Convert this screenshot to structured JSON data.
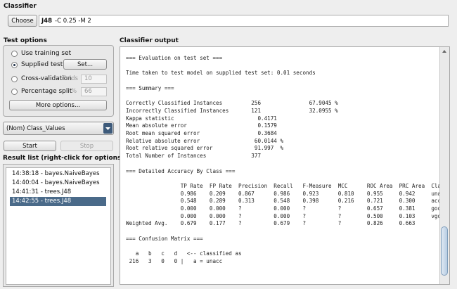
{
  "classifier": {
    "section_title": "Classifier",
    "choose_label": "Choose",
    "algo_name": "J48",
    "algo_args": "-C 0.25 -M 2"
  },
  "test_options": {
    "title": "Test options",
    "use_training": "Use training set",
    "supplied_test": "Supplied test set",
    "set_label": "Set...",
    "cross_validation": "Cross-validation",
    "folds_label": "Folds",
    "folds_value": "10",
    "percentage_split": "Percentage split",
    "percent_label": "%",
    "percent_value": "66",
    "selected": "supplied_test",
    "more_options": "More options..."
  },
  "class_select": {
    "value": "(Nom) Class_Values"
  },
  "controls": {
    "start": "Start",
    "stop": "Stop"
  },
  "result_list": {
    "title": "Result list (right-click for options)",
    "items": [
      "14:38:18 - bayes.NaiveBayes",
      "14:40:04 - bayes.NaiveBayes",
      "14:41:31 - trees.J48",
      "14:42:55 - trees.J48"
    ],
    "selected_index": 3
  },
  "output": {
    "title": "Classifier output",
    "text": "=== Evaluation on test set ===\n\nTime taken to test model on supplied test set: 0.01 seconds\n\n=== Summary ===\n\nCorrectly Classified Instances         256               67.9045 %\nIncorrectly Classified Instances       121               32.0955 %\nKappa statistic                          0.4171\nMean absolute error                      0.1579\nRoot mean squared error                  0.3684\nRelative absolute error                 60.0144 %\nRoot relative squared error             91.997  %\nTotal Number of Instances              377\n\n=== Detailed Accuracy By Class ===\n\n                 TP Rate  FP Rate  Precision  Recall   F-Measure  MCC      ROC Area  PRC Area  Class\n                 0.986    0.209    0.867      0.986    0.923      0.810    0.955     0.942     unacc\n                 0.548    0.289    0.313      0.548    0.398      0.216    0.721     0.300     acc\n                 0.000    0.000    ?          0.000    ?          ?        0.657     0.381     good\n                 0.000    0.000    ?          0.000    ?          ?        0.500     0.103     vgood\nWeighted Avg.    0.679    0.177    ?          0.679    ?          ?        0.826     0.663\n\n=== Confusion Matrix ===\n\n   a   b   c   d   <-- classified as\n 216   3   0   0 |   a = unacc"
  }
}
